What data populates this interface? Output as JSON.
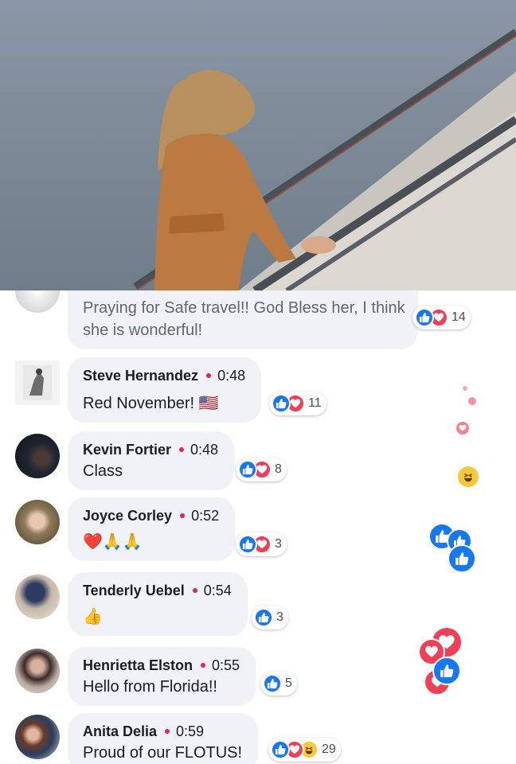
{
  "colors": {
    "like": "#1877f2",
    "love": "#f33e58",
    "timestamp_dot": "#e0245e",
    "bubble": "#f0f2f5"
  },
  "comments": [
    {
      "author": "",
      "time": "",
      "text": "Praying for Safe travel!! God Bless her,  I think she is wonderful!",
      "reaction_icons": [
        "like-icon",
        "love-icon"
      ],
      "reaction_count": "14"
    },
    {
      "author": "Steve Hernandez",
      "time": "0:48",
      "text": "Red November! 🇺🇸",
      "reaction_icons": [
        "like-icon",
        "love-icon"
      ],
      "reaction_count": "11"
    },
    {
      "author": "Kevin Fortier",
      "time": "0:48",
      "text": "Class",
      "reaction_icons": [
        "like-icon",
        "love-icon"
      ],
      "reaction_count": "8"
    },
    {
      "author": "Joyce Corley",
      "time": "0:52",
      "text": "❤️🙏🙏",
      "reaction_icons": [
        "like-icon",
        "love-icon"
      ],
      "reaction_count": "3"
    },
    {
      "author": "Tenderly Uebel",
      "time": "0:54",
      "text": "👍",
      "reaction_icons": [
        "like-icon"
      ],
      "reaction_count": "3"
    },
    {
      "author": "Henrietta Elston",
      "time": "0:55",
      "text": "Hello from Florida!!",
      "reaction_icons": [
        "like-icon"
      ],
      "reaction_count": "5"
    },
    {
      "author": "Anita Delia",
      "time": "0:59",
      "text": "Proud of our FLOTUS!",
      "reaction_icons": [
        "like-icon",
        "love-icon",
        "haha-icon"
      ],
      "reaction_count": "29"
    }
  ],
  "floating_reactions": [
    "love-icon",
    "love-icon",
    "love-icon",
    "haha-icon",
    "like-icon",
    "like-icon",
    "like-icon",
    "love-icon",
    "love-icon",
    "like-icon",
    "love-icon"
  ]
}
